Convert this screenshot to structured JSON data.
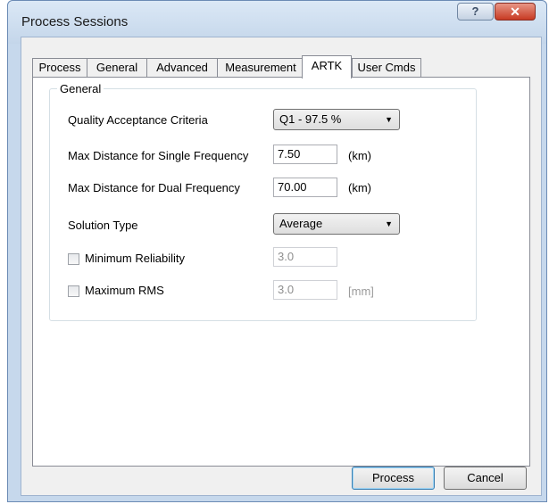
{
  "window": {
    "title": "Process Sessions",
    "help_glyph": "?",
    "close_glyph": "✕"
  },
  "tabs": [
    {
      "label": "Process"
    },
    {
      "label": "General"
    },
    {
      "label": "Advanced"
    },
    {
      "label": "Measurement"
    },
    {
      "label": "ARTK",
      "selected": true
    },
    {
      "label": "User Cmds"
    }
  ],
  "group": {
    "title": "General",
    "quality": {
      "label": "Quality Acceptance Criteria",
      "value": "Q1 - 97.5 %"
    },
    "single_freq": {
      "label": "Max Distance for Single Frequency",
      "value": "7.50",
      "unit": "(km)"
    },
    "dual_freq": {
      "label": "Max Distance for Dual Frequency",
      "value": "70.00",
      "unit": "(km)"
    },
    "solution_type": {
      "label": "Solution Type",
      "value": "Average"
    },
    "min_reliability": {
      "label": "Minimum Reliability",
      "checked": false,
      "value": "3.0"
    },
    "max_rms": {
      "label": "Maximum RMS",
      "checked": false,
      "value": "3.0",
      "unit": "[mm]"
    }
  },
  "buttons": {
    "process": "Process",
    "cancel": "Cancel"
  },
  "icons": {
    "dropdown_arrow": "chevron-down-icon",
    "close": "close-icon",
    "help": "help-icon"
  },
  "colors": {
    "frame": "#c6d8ec",
    "close_button": "#c73a23",
    "default_button_border": "#3c7fb1"
  }
}
